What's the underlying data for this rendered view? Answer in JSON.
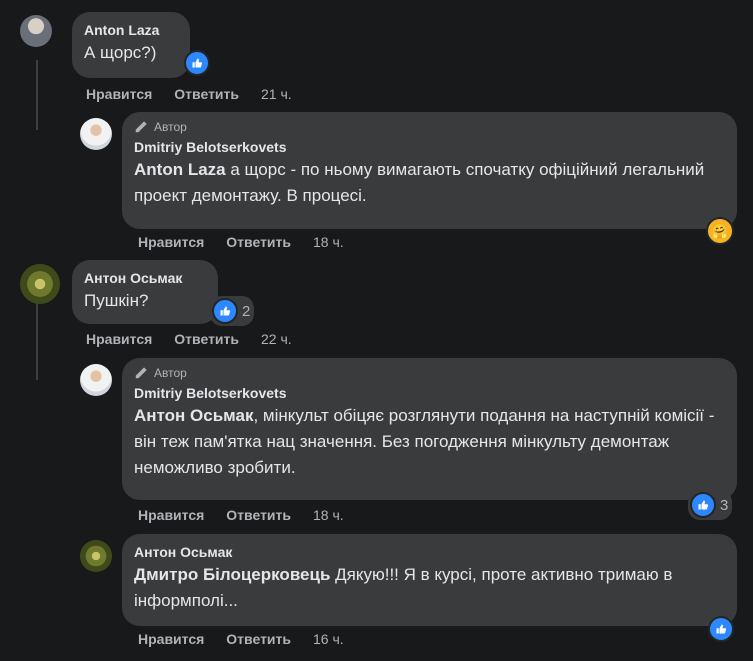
{
  "actions": {
    "like": "Нравится",
    "reply": "Ответить"
  },
  "author_tag": "Автор",
  "comments": [
    {
      "name": "Anton Laza",
      "text": "А щорс?)",
      "time": "21 ч.",
      "reaction": {
        "icon": "like-icon",
        "count": ""
      }
    },
    {
      "name": "Dmitriy Belotserkovets",
      "mention": "Anton Laza",
      "text": " а щорс - по ньому вимагають спочатку офіційний легальний проект демонтажу. В процесі.",
      "time": "18 ч.",
      "reaction": {
        "icon": "care-icon",
        "count": ""
      }
    },
    {
      "name": "Антон Осьмак",
      "text": "Пушкін?",
      "time": "22 ч.",
      "reaction": {
        "icon": "like-icon",
        "count": "2"
      }
    },
    {
      "name": "Dmitriy Belotserkovets",
      "mention": "Антон Осьмак",
      "text": ", мінкульт обіцяє розглянути подання на наступній комісії - він теж пам'ятка нац значення. Без погодження мінкульту демонтаж неможливо зробити.",
      "time": "18 ч.",
      "reaction": {
        "icon": "like-icon",
        "count": "3"
      }
    },
    {
      "name": "Антон Осьмак",
      "mention": "Дмитро Білоцерковець",
      "text": " Дякую!!! Я в курсі, проте активно тримаю в інформполі...",
      "time": "16 ч.",
      "reaction": {
        "icon": "like-icon",
        "count": ""
      }
    }
  ],
  "colors": {
    "background": "#18191a",
    "bubble": "#3a3b3c",
    "like": "#2d88ff",
    "meta": "#b0b3b8"
  }
}
